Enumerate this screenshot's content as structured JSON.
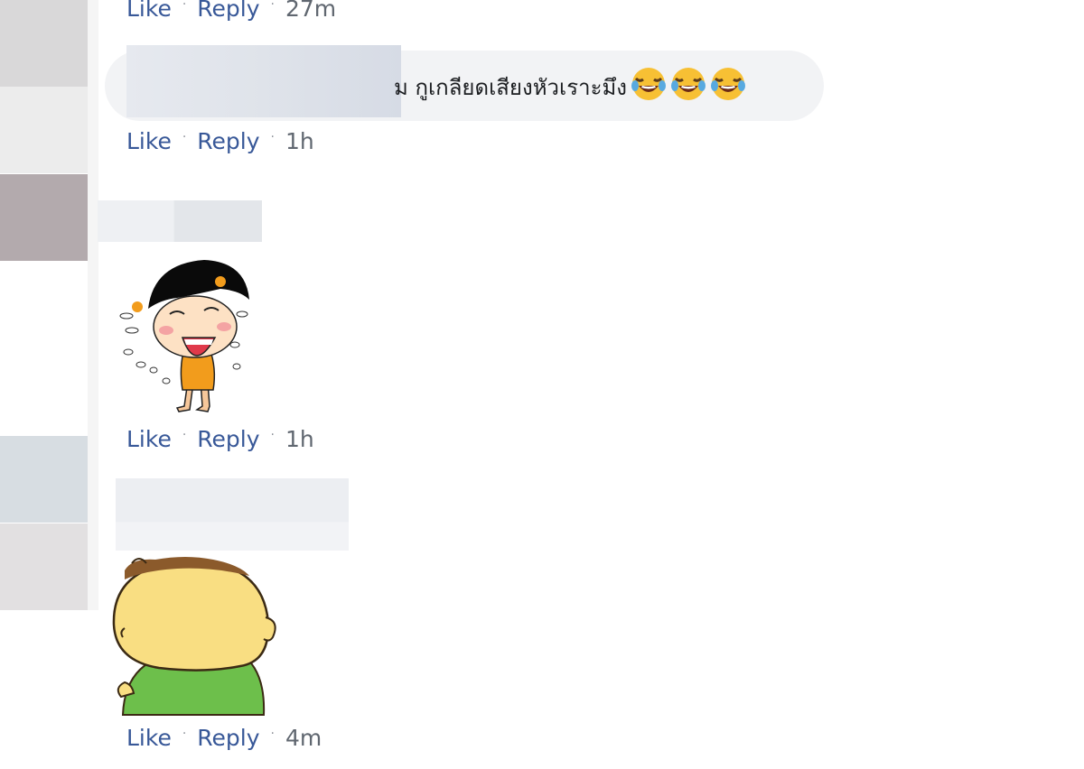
{
  "comments": [
    {
      "actions": {
        "like": "Like",
        "reply": "Reply",
        "time": "27m"
      }
    },
    {
      "text": "ม กูเกลียดเสียงหัวเราะมึง",
      "emoji": [
        "face-with-tears-of-joy",
        "face-with-tears-of-joy",
        "face-with-tears-of-joy"
      ],
      "actions": {
        "like": "Like",
        "reply": "Reply",
        "time": "1h"
      }
    },
    {
      "sticker": "crying-girl-sticker",
      "actions": {
        "like": "Like",
        "reply": "Reply",
        "time": "1h"
      }
    },
    {
      "sticker": "round-head-boy-sticker",
      "actions": {
        "like": "Like",
        "reply": "Reply",
        "time": "4m"
      }
    }
  ],
  "separator": "·",
  "colors": {
    "link": "#385898",
    "bubble": "#f2f3f5",
    "text": "#1c1e21"
  }
}
